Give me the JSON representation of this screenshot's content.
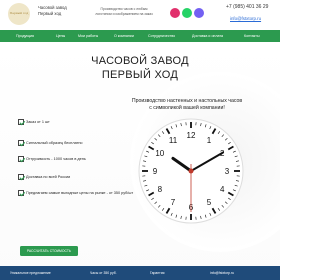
{
  "header": {
    "logo_text": "Первый ход",
    "brand_line1": "Часовой завод",
    "brand_line2": "Первый ход",
    "tagline_line1": "Производство часов с любым",
    "tagline_line2": "логотипом и изображением на заказ",
    "phone": "+7 (985) 401 36 29",
    "email": "info@fstxtorp.ru",
    "social_icons": [
      "instagram-icon",
      "whatsapp-icon",
      "viber-icon"
    ]
  },
  "nav": {
    "items": [
      "Продукция",
      "Цены",
      "Мои работы",
      "О компании",
      "Сотрудничество",
      "Доставка и оплата",
      "Контакты"
    ]
  },
  "hero": {
    "title_line1": "ЧАСОВОЙ ЗАВОД",
    "title_line2": "ПЕРВЫЙ ХОД",
    "subtitle_line1": "Производство настенных и настольных часов",
    "subtitle_line2": "с символикой вашей компании!",
    "features": [
      "Заказ от 1 шт",
      "Сигнальный образец бесплатно",
      "Отгрузимость - 1000 часов в день",
      "Доставка по всей России",
      "Предлагаем самые выгодные цены на рынке - от 350 руб/шт"
    ],
    "cta_label": "РАССЧИТАТЬ СТОИМОСТЬ"
  },
  "clock": {
    "numbers": [
      "12",
      "1",
      "2",
      "3",
      "4",
      "5",
      "6",
      "7",
      "8",
      "9",
      "10",
      "11"
    ],
    "hour": 10,
    "minute": 10,
    "second": 30,
    "accent_color": "#c0392b"
  },
  "footer": {
    "items": [
      "Уникальное предложение",
      "Часы от 350 руб.",
      "Гарантия",
      "info@fstxtorp.ru"
    ]
  },
  "colors": {
    "nav_bg": "#2c9a4f",
    "footer_bg": "#1f4b7a",
    "link": "#2a6bd6"
  }
}
